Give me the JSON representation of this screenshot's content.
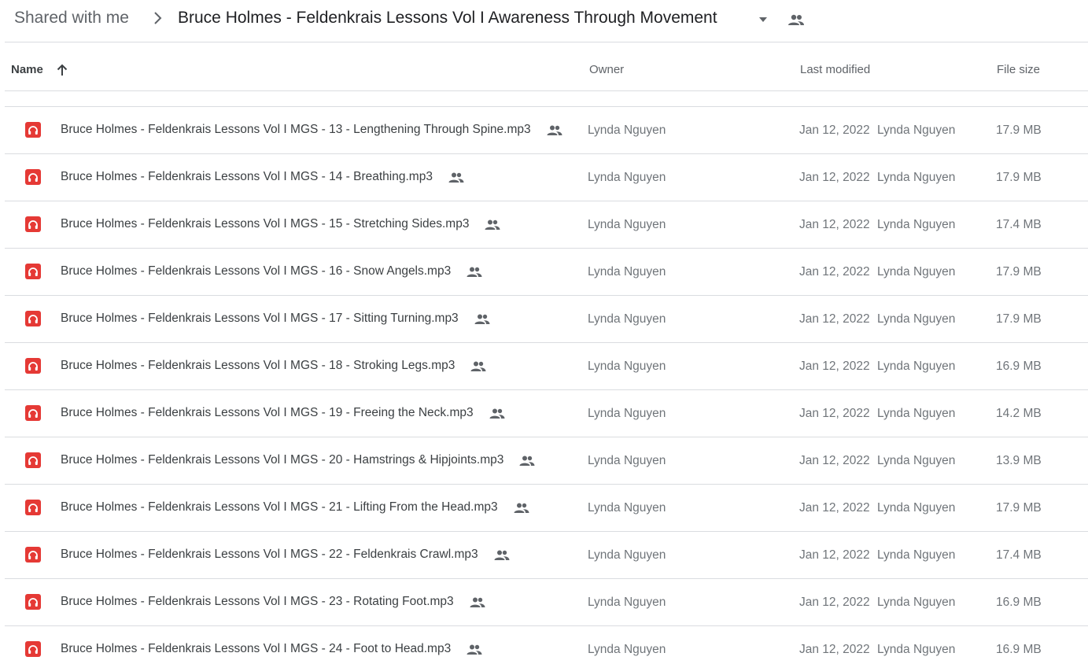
{
  "breadcrumb": {
    "root": "Shared with me",
    "current": "Bruce Holmes - Feldenkrais Lessons Vol I Awareness Through Movement"
  },
  "columns": {
    "name": "Name",
    "owner": "Owner",
    "last_modified": "Last modified",
    "file_size": "File size"
  },
  "colors": {
    "audio_icon": "#e53935",
    "divider": "#dadce0",
    "secondary_text": "#70757a"
  },
  "files": [
    {
      "name": "Bruce Holmes - Feldenkrais Lessons Vol I MGS - 13 - Lengthening Through Spine.mp3",
      "owner": "Lynda Nguyen",
      "modified_date": "Jan 12, 2022",
      "modified_by": "Lynda Nguyen",
      "size": "17.9 MB"
    },
    {
      "name": "Bruce Holmes - Feldenkrais Lessons Vol I MGS - 14 - Breathing.mp3",
      "owner": "Lynda Nguyen",
      "modified_date": "Jan 12, 2022",
      "modified_by": "Lynda Nguyen",
      "size": "17.9 MB"
    },
    {
      "name": "Bruce Holmes - Feldenkrais Lessons Vol I MGS - 15 - Stretching Sides.mp3",
      "owner": "Lynda Nguyen",
      "modified_date": "Jan 12, 2022",
      "modified_by": "Lynda Nguyen",
      "size": "17.4 MB"
    },
    {
      "name": "Bruce Holmes - Feldenkrais Lessons Vol I MGS - 16 - Snow Angels.mp3",
      "owner": "Lynda Nguyen",
      "modified_date": "Jan 12, 2022",
      "modified_by": "Lynda Nguyen",
      "size": "17.9 MB"
    },
    {
      "name": "Bruce Holmes - Feldenkrais Lessons Vol I MGS - 17 - Sitting Turning.mp3",
      "owner": "Lynda Nguyen",
      "modified_date": "Jan 12, 2022",
      "modified_by": "Lynda Nguyen",
      "size": "17.9 MB"
    },
    {
      "name": "Bruce Holmes - Feldenkrais Lessons Vol I MGS - 18 - Stroking Legs.mp3",
      "owner": "Lynda Nguyen",
      "modified_date": "Jan 12, 2022",
      "modified_by": "Lynda Nguyen",
      "size": "16.9 MB"
    },
    {
      "name": "Bruce Holmes - Feldenkrais Lessons Vol I MGS - 19 - Freeing the Neck.mp3",
      "owner": "Lynda Nguyen",
      "modified_date": "Jan 12, 2022",
      "modified_by": "Lynda Nguyen",
      "size": "14.2 MB"
    },
    {
      "name": "Bruce Holmes - Feldenkrais Lessons Vol I MGS - 20 - Hamstrings & Hipjoints.mp3",
      "owner": "Lynda Nguyen",
      "modified_date": "Jan 12, 2022",
      "modified_by": "Lynda Nguyen",
      "size": "13.9 MB"
    },
    {
      "name": "Bruce Holmes - Feldenkrais Lessons Vol I MGS - 21 - Lifting From the Head.mp3",
      "owner": "Lynda Nguyen",
      "modified_date": "Jan 12, 2022",
      "modified_by": "Lynda Nguyen",
      "size": "17.9 MB"
    },
    {
      "name": "Bruce Holmes - Feldenkrais Lessons Vol I MGS - 22 - Feldenkrais Crawl.mp3",
      "owner": "Lynda Nguyen",
      "modified_date": "Jan 12, 2022",
      "modified_by": "Lynda Nguyen",
      "size": "17.4 MB"
    },
    {
      "name": "Bruce Holmes - Feldenkrais Lessons Vol I MGS - 23 - Rotating Foot.mp3",
      "owner": "Lynda Nguyen",
      "modified_date": "Jan 12, 2022",
      "modified_by": "Lynda Nguyen",
      "size": "16.9 MB"
    },
    {
      "name": "Bruce Holmes - Feldenkrais Lessons Vol I MGS - 24 - Foot to Head.mp3",
      "owner": "Lynda Nguyen",
      "modified_date": "Jan 12, 2022",
      "modified_by": "Lynda Nguyen",
      "size": "16.9 MB"
    }
  ]
}
